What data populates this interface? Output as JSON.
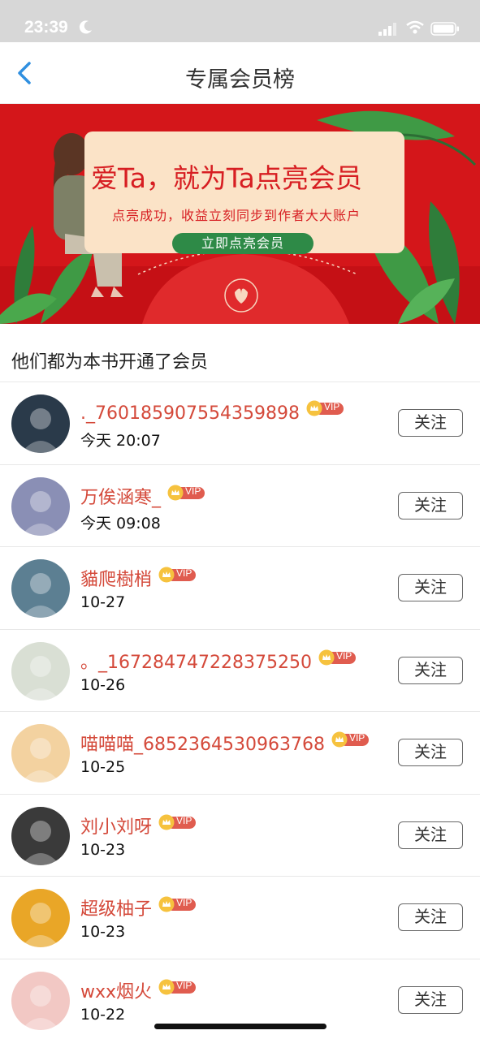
{
  "status_bar": {
    "time": "23:39"
  },
  "nav": {
    "title": "专属会员榜"
  },
  "banner": {
    "headline": "爱Ta，就为Ta点亮会员",
    "subtitle": "点亮成功，收益立刻同步到作者大大账户",
    "button_label": "立即点亮会员"
  },
  "section_title": "他们都为本书开通了会员",
  "vip_label": "VIP",
  "follow_label": "关注",
  "members": [
    {
      "name": "._760185907554359898",
      "date": "今天 20:07",
      "avatar_color": "#2a3a4a"
    },
    {
      "name": "万俟涵寒_",
      "date": "今天 09:08",
      "avatar_color": "#8a8fb5"
    },
    {
      "name": "貓爬樹梢",
      "date": "10-27",
      "avatar_color": "#5c7f92"
    },
    {
      "name": "。_167284747228375250",
      "date": "10-26",
      "avatar_color": "#d9dfd4"
    },
    {
      "name": "喵喵喵_6852364530963768",
      "date": "10-25",
      "avatar_color": "#f3d2a0"
    },
    {
      "name": "刘小刘呀",
      "date": "10-23",
      "avatar_color": "#3a3a3a"
    },
    {
      "name": "超级柚子",
      "date": "10-23",
      "avatar_color": "#e9a627"
    },
    {
      "name": "wxx烟火",
      "date": "10-22",
      "avatar_color": "#f2c8c4"
    }
  ]
}
